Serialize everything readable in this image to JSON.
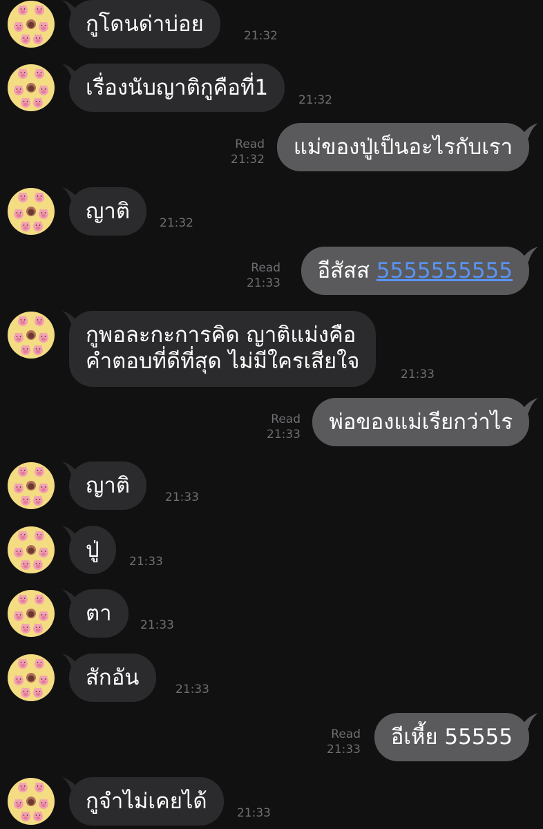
{
  "chat": {
    "messages": [
      {
        "side": "in",
        "text": "กูโดนด่าบ่อย",
        "time": "21:32"
      },
      {
        "side": "in",
        "text": "เรื่องนับญาติกูคือที่1",
        "time": "21:32"
      },
      {
        "side": "out",
        "text": "แม่ของปู่เป็นอะไรกับเรา",
        "status": "Read",
        "time": "21:32"
      },
      {
        "side": "in",
        "text": "ญาติ",
        "time": "21:32"
      },
      {
        "side": "out",
        "text": "อีสัสส",
        "link": "5555555555",
        "status": "Read",
        "time": "21:33"
      },
      {
        "side": "in",
        "line1": "กูพอละกะการคิด ญาติแม่งคือ",
        "line2": "คำตอบที่ดีที่สุด ไม่มีใครเสียใจ",
        "time": "21:33"
      },
      {
        "side": "out",
        "text": "พ่อของแม่เรียกว่าไร",
        "status": "Read",
        "time": "21:33"
      },
      {
        "side": "in",
        "text": "ญาติ",
        "time": "21:33"
      },
      {
        "side": "in",
        "text": "ปู่",
        "time": "21:33"
      },
      {
        "side": "in",
        "text": "ตา",
        "time": "21:33"
      },
      {
        "side": "in",
        "text": "สักอัน",
        "time": "21:33"
      },
      {
        "side": "out",
        "text": "อีเหี้ย 55555",
        "status": "Read",
        "time": "21:33"
      },
      {
        "side": "in",
        "text": "กูจำไม่เคยได้",
        "time": "21:33"
      }
    ]
  },
  "colors": {
    "background": "#111112",
    "incoming_bubble": "#2b2b2d",
    "outgoing_bubble": "#5a5a5c",
    "link": "#5a93f4",
    "avatar_bg": "#f3dc82"
  },
  "icons": {
    "avatar": "pig-sticker-avatar-icon"
  }
}
